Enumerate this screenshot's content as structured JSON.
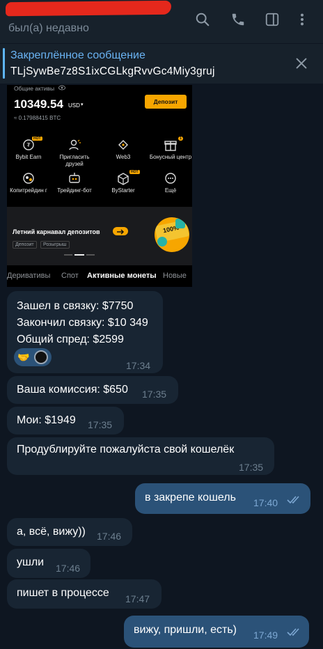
{
  "header": {
    "status": "был(а) недавно",
    "icons": [
      "search-icon",
      "phone-icon",
      "sidebar-toggle-icon",
      "more-vertical-icon"
    ]
  },
  "pinned": {
    "title": "Закреплённое сообщение",
    "text": "TLjSywBe7z8S1ixCGLkgRvvGc4Miy3gruj"
  },
  "screenshot": {
    "assets_label": "Общие активы",
    "balance": "10349.54",
    "currency": "USD",
    "btc": "≈ 0.17988415 BTC",
    "deposit": "Депозит",
    "grid": [
      {
        "label": "Bybit Earn",
        "badge": "HOT"
      },
      {
        "label": "Пригласить друзей",
        "badge": ""
      },
      {
        "label": "Web3",
        "badge": ""
      },
      {
        "label": "Бонусный центр",
        "badge": "1"
      },
      {
        "label": "Копитрейдин г",
        "badge": ""
      },
      {
        "label": "Трейдинг-бот",
        "badge": ""
      },
      {
        "label": "ByStarter",
        "badge": "HOT"
      },
      {
        "label": "Ещё",
        "badge": ""
      }
    ],
    "promo_title": "Летний карнавал депозитов",
    "promo_tags": [
      "Депозит",
      "Розыгрыш"
    ],
    "promo_badge": "100%",
    "tabs": [
      "Деривативы",
      "Спот",
      "Активные монеты",
      "Новые"
    ]
  },
  "messages": [
    {
      "dir": "in",
      "lines": [
        "Зашел в связку: $7750",
        "Закончил связку: $10 349",
        "Общий спред: $2599"
      ],
      "time": "17:34",
      "reactions": [
        "handshake-emoji",
        "avatar"
      ]
    },
    {
      "dir": "in",
      "text": "Ваша комиссия: $650",
      "time": "17:35"
    },
    {
      "dir": "in",
      "text": "Мои: $1949",
      "time": "17:35"
    },
    {
      "dir": "in",
      "text": "Продублируйте пожалуйста свой кошелёк",
      "time": "17:35"
    },
    {
      "dir": "out",
      "text": "в закрепе кошель",
      "time": "17:40",
      "read": true
    },
    {
      "dir": "in",
      "text": "а, всё, вижу))",
      "time": "17:46"
    },
    {
      "dir": "in",
      "text": "ушли",
      "time": "17:46"
    },
    {
      "dir": "in",
      "text": "пишет в процессе",
      "time": "17:47"
    },
    {
      "dir": "out",
      "text": "вижу, пришли, есть)",
      "time": "17:49",
      "read": true
    }
  ],
  "colors": {
    "background": "#0e1621",
    "header": "#17212b",
    "incoming": "#182533",
    "outgoing": "#2b5278",
    "accent": "#6ab3f3",
    "bybit_orange": "#f7a600"
  }
}
